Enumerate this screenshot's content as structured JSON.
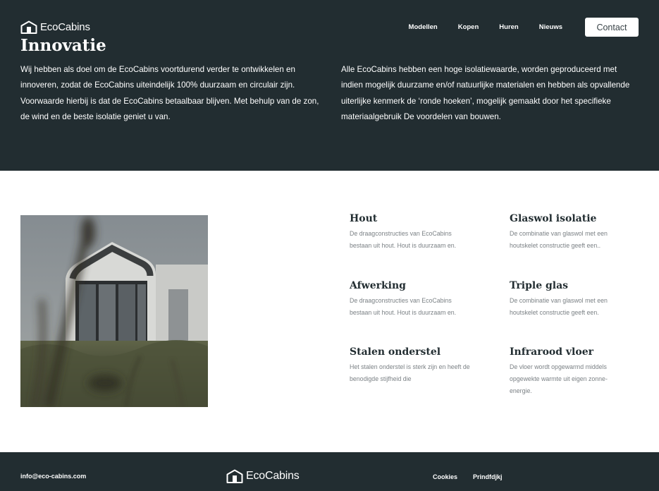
{
  "brand": {
    "name": "EcoCabins"
  },
  "nav": {
    "items": [
      {
        "label": "Modellen"
      },
      {
        "label": "Kopen"
      },
      {
        "label": "Huren"
      },
      {
        "label": "Nieuws"
      }
    ],
    "contact_label": "Contact"
  },
  "hero": {
    "title": "Innovatie",
    "left_text": "Wij hebben als doel om de EcoCabins voortdurend verder te ontwikkelen en innoveren, zodat de EcoCabins uiteindelijk 100% duurzaam en circulair zijn. Voorwaarde hierbij is dat de EcoCabins betaalbaar blijven. Met behulp van de zon, de wind en de beste isolatie geniet u van.",
    "right_text": "Alle EcoCabins hebben een hoge isolatiewaarde, worden geproduceerd met indien mogelijk duurzame en/of natuurlijke materialen en hebben als opvallende uiterlijke kenmerk de ‘ronde hoeken’, mogelijk gemaakt door het specifieke materiaalgebruik De voordelen van bouwen."
  },
  "features": [
    {
      "title": "Hout",
      "text": "De draagconstructies van EcoCabins bestaan uit hout. Hout is duurzaam en."
    },
    {
      "title": "Glaswol isolatie",
      "text": "De combinatie van glaswol met een houtskelet constructie geeft een.."
    },
    {
      "title": "Afwerking",
      "text": "De draagconstructies van EcoCabins bestaan uit hout. Hout is duurzaam en."
    },
    {
      "title": "Triple glas",
      "text": "De combinatie van glaswol met een houtskelet constructie geeft een."
    },
    {
      "title": "Stalen onderstel",
      "text": "Het stalen onderstel is sterk zijn en heeft de benodigde stijfheid die"
    },
    {
      "title": "Infrarood vloer",
      "text": "De vloer wordt opgewarmd middels opgewekte warmte uit eigen zonne-energie."
    }
  ],
  "footer": {
    "email": "info@eco-cabins.com",
    "links": [
      {
        "label": "Cookies"
      },
      {
        "label": "Prindfdjkj"
      }
    ]
  },
  "colors": {
    "dark": "#222d31",
    "white": "#ffffff",
    "muted_text": "#7b8185"
  }
}
